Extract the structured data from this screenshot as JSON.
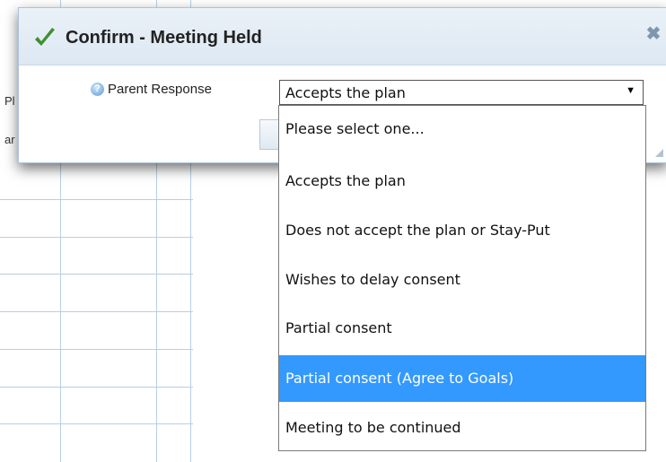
{
  "background": {
    "fragments": [
      "Pl",
      "ar"
    ]
  },
  "dialog": {
    "title": "Confirm - Meeting Held",
    "close_symbol": "✖",
    "check_icon": "checkmark-icon",
    "help_symbol": "?",
    "field_label": "Parent Response",
    "select_value": "Accepts the plan",
    "select_arrow": "▼"
  },
  "dropdown": {
    "options": [
      "Please select one...",
      "Accepts the plan",
      "Does not accept the plan or Stay-Put",
      "Wishes to delay consent",
      "Partial consent",
      "Partial consent (Agree to Goals)",
      "Meeting to be continued"
    ],
    "highlighted": "Partial consent (Agree to Goals)"
  },
  "colors": {
    "highlight": "#3399ff",
    "check": "#3f8f2f",
    "header_bg": "#e4edf6",
    "grid": "#b8cfe3"
  }
}
